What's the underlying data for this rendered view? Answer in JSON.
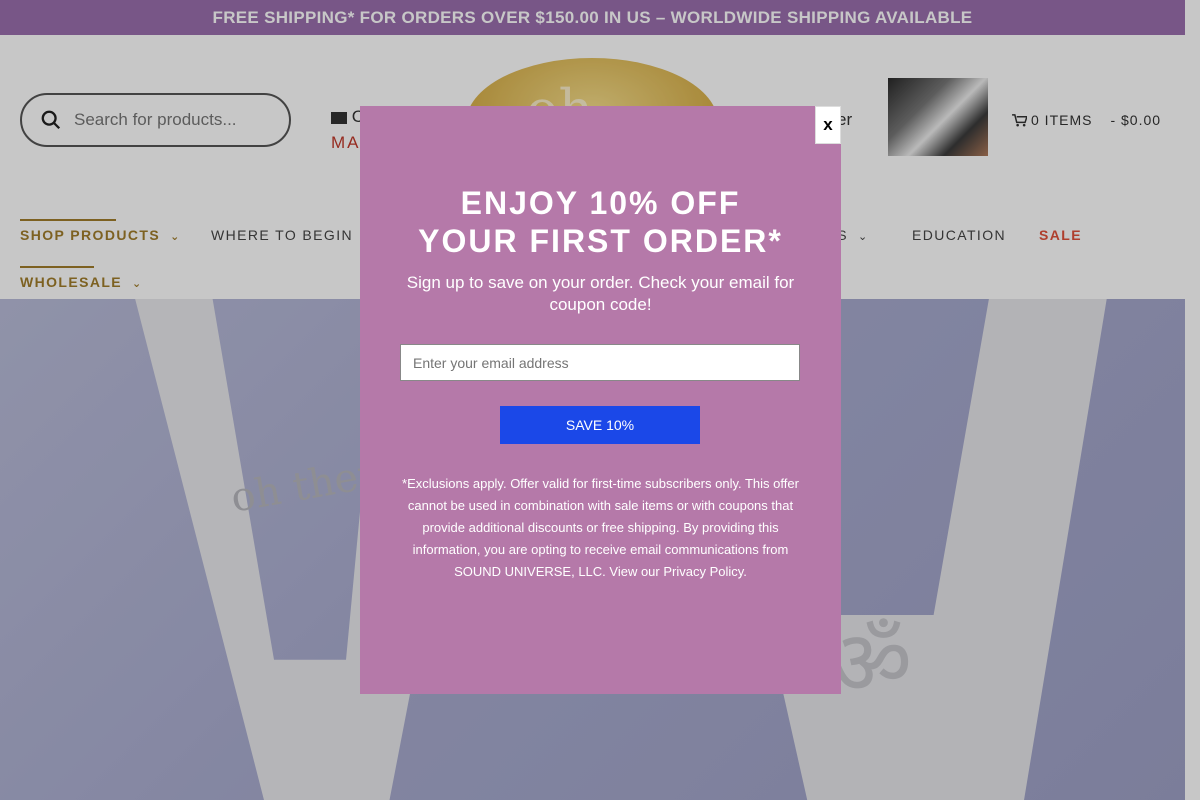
{
  "announcement": "FREE SHIPPING* FOR ORDERS OVER $150.00 IN US – WORLDWIDE SHIPPING AVAILABLE",
  "search": {
    "placeholder": "Search for products..."
  },
  "contact": {
    "label": "C",
    "link": "MA"
  },
  "logo": {
    "text": "oh"
  },
  "account": {
    "register_label": "ister"
  },
  "cart": {
    "items_label": "0 ITEMS",
    "total": "- $0.00"
  },
  "nav": {
    "items": [
      "SHOP PRODUCTS",
      "WHERE TO BEGIN",
      "RKS",
      "EDUCATION",
      "SALE",
      "WHOLESALE"
    ]
  },
  "hero": {
    "engraving": "oh therap",
    "symbol": "ॐ"
  },
  "popup": {
    "close_label": "x",
    "title_line1": "ENJOY 10% OFF",
    "title_line2": "YOUR FIRST ORDER*",
    "subtitle": "Sign up to save on your order. Check your email for coupon code!",
    "email_placeholder": "Enter your email address",
    "button_label": "SAVE 10%",
    "disclaimer": "*Exclusions apply. Offer valid for first-time subscribers only. This offer cannot be used in combination with sale items or with coupons that provide additional discounts or free shipping. By providing this information, you are opting to receive email communications from SOUND UNIVERSE, LLC. View our Privacy Policy."
  },
  "colors": {
    "announcement_bg": "#9a6fae",
    "popup_bg": "#b579a9",
    "button_bg": "#1b48e8",
    "nav_gold": "#a07d2b",
    "sale_red": "#e1513a"
  }
}
